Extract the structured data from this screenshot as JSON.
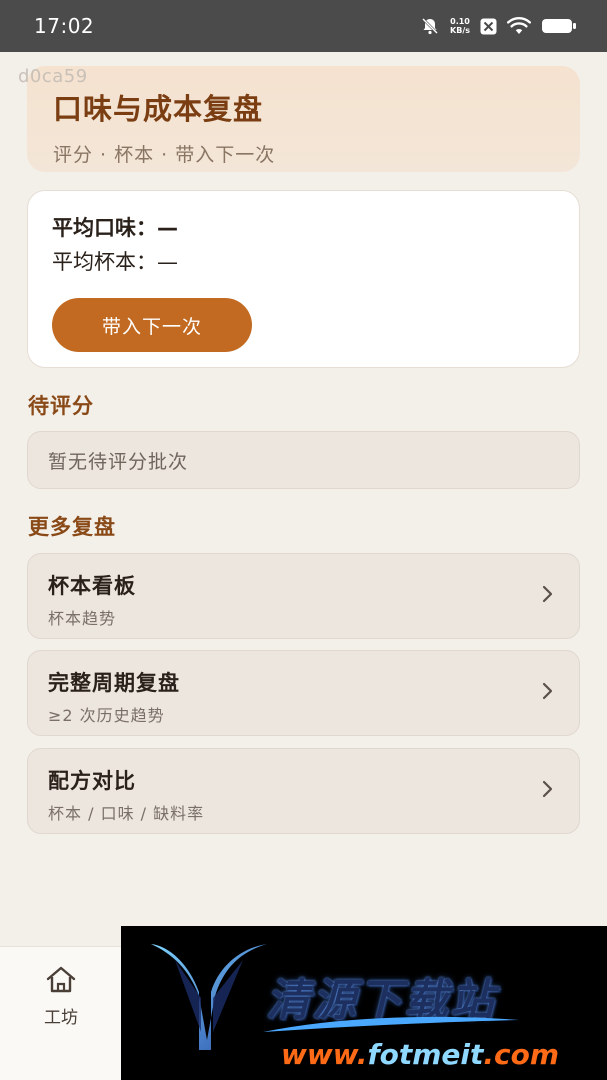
{
  "status_bar": {
    "time": "17:02",
    "net_speed_value": "0.10",
    "net_speed_unit": "KB/s",
    "icons": [
      "mute-bell-icon",
      "x-app-icon",
      "wifi-icon",
      "battery-icon"
    ]
  },
  "watermark_id": "d0ca59",
  "header": {
    "title": "口味与成本复盘",
    "subtitle": "评分 · 杯本 · 带入下一次"
  },
  "stats": {
    "avg_taste": "平均口味：—",
    "avg_cup_cost": "平均杯本：—",
    "carry_button": "带入下一次"
  },
  "pending": {
    "title": "待评分",
    "empty_text": "暂无待评分批次"
  },
  "more": {
    "title": "更多复盘",
    "items": [
      {
        "title": "杯本看板",
        "subtitle": "杯本趋势"
      },
      {
        "title": "完整周期复盘",
        "subtitle": "≥2 次历史趋势"
      },
      {
        "title": "配方对比",
        "subtitle": "杯本 / 口味 / 缺料率"
      }
    ]
  },
  "tabbar": {
    "home_label": "工坊"
  },
  "ad_banner": {
    "title": "清源下载站",
    "url_part1": "www.",
    "url_part2": "fotmeit",
    "url_part3": ".com"
  },
  "colors": {
    "accent": "#c26a21",
    "header_title": "#7a3e12",
    "section_title": "#8a4a18",
    "background": "#f3efe9",
    "status_bar": "#4b4b4b"
  }
}
